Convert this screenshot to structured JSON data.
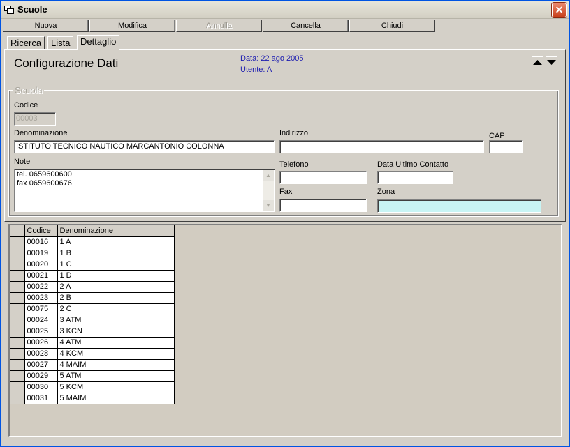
{
  "window": {
    "title": "Scuole",
    "close_glyph": "✕"
  },
  "toolbar": {
    "buttons": [
      {
        "label": "Nuova",
        "enabled": true
      },
      {
        "label": "Modifica",
        "enabled": true
      },
      {
        "label": "Annulla",
        "enabled": false
      },
      {
        "label": "Cancella",
        "enabled": true
      },
      {
        "label": "Chiudi",
        "enabled": true
      }
    ]
  },
  "tabs": [
    "Ricerca",
    "Lista",
    "Dettaglio"
  ],
  "active_tab": "Dettaglio",
  "header": {
    "title": "Configurazione Dati",
    "date_line": "Data: 22 ago 2005",
    "user_line": "Utente: A",
    "info_color": "#1c1cb0"
  },
  "form": {
    "group_label": "Scuola",
    "codice": {
      "label": "Codice",
      "value": "00003"
    },
    "denominazione": {
      "label": "Denominazione",
      "value": "ISTITUTO TECNICO NAUTICO MARCANTONIO COLONNA"
    },
    "indirizzo": {
      "label": "Indirizzo",
      "value": ""
    },
    "cap": {
      "label": "CAP",
      "value": ""
    },
    "note": {
      "label": "Note",
      "lines": [
        "tel. 0659600600",
        "fax 0659600676"
      ]
    },
    "telefono": {
      "label": "Telefono",
      "value": ""
    },
    "data_ultimo_contatto": {
      "label": "Data Ultimo Contatto",
      "value": ""
    },
    "fax": {
      "label": "Fax",
      "value": ""
    },
    "zona": {
      "label": "Zona",
      "value": "",
      "color": "#c8f4f4"
    }
  },
  "grid": {
    "columns": [
      "Codice",
      "Denominazione"
    ],
    "rows": [
      [
        "00016",
        "1 A"
      ],
      [
        "00019",
        "1 B"
      ],
      [
        "00020",
        "1 C"
      ],
      [
        "00021",
        "1 D"
      ],
      [
        "00022",
        "2 A"
      ],
      [
        "00023",
        "2 B"
      ],
      [
        "00075",
        "2 C"
      ],
      [
        "00024",
        "3 ATM"
      ],
      [
        "00025",
        "3 KCN"
      ],
      [
        "00026",
        "4 ATM"
      ],
      [
        "00028",
        "4 KCM"
      ],
      [
        "00027",
        "4 MAIM"
      ],
      [
        "00029",
        "5 ATM"
      ],
      [
        "00030",
        "5 KCM"
      ],
      [
        "00031",
        "5 MAIM"
      ]
    ]
  },
  "icons": {
    "window_icon": "app-icon",
    "up": "arrow-up-icon",
    "down": "arrow-down-icon"
  }
}
